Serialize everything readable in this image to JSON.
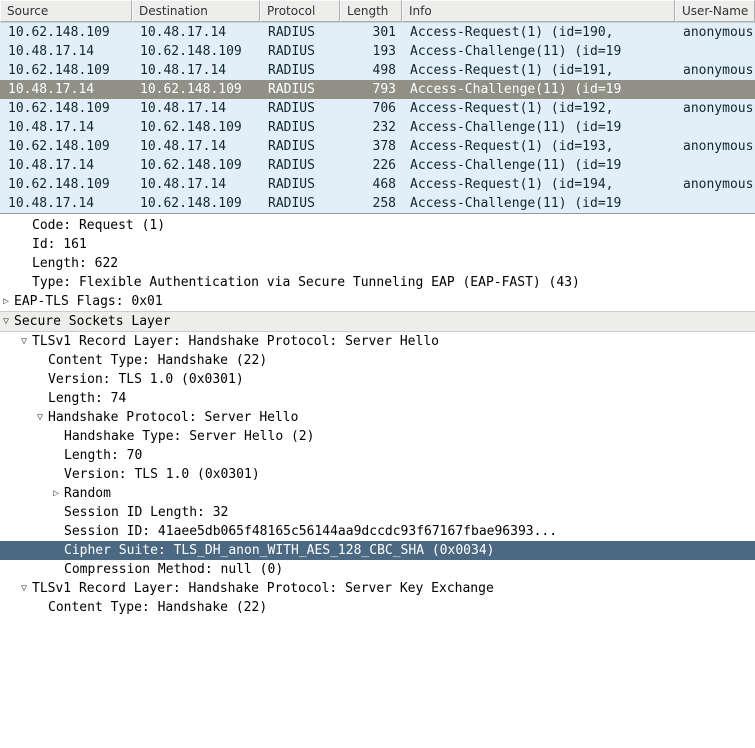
{
  "columns": {
    "source": "Source",
    "dest": "Destination",
    "proto": "Protocol",
    "length": "Length",
    "info": "Info",
    "user": "User-Name"
  },
  "packets": [
    {
      "source": "10.62.148.109",
      "dest": "10.48.17.14",
      "proto": "RADIUS",
      "length": "301",
      "info": "Access-Request(1) (id=190,",
      "user": "anonymous",
      "selected": false
    },
    {
      "source": "10.48.17.14",
      "dest": "10.62.148.109",
      "proto": "RADIUS",
      "length": "193",
      "info": "Access-Challenge(11) (id=19",
      "user": "",
      "selected": false
    },
    {
      "source": "10.62.148.109",
      "dest": "10.48.17.14",
      "proto": "RADIUS",
      "length": "498",
      "info": "Access-Request(1) (id=191,",
      "user": "anonymous",
      "selected": false
    },
    {
      "source": "10.48.17.14",
      "dest": "10.62.148.109",
      "proto": "RADIUS",
      "length": "793",
      "info": "Access-Challenge(11) (id=19",
      "user": "",
      "selected": true
    },
    {
      "source": "10.62.148.109",
      "dest": "10.48.17.14",
      "proto": "RADIUS",
      "length": "706",
      "info": "Access-Request(1) (id=192,",
      "user": "anonymous",
      "selected": false
    },
    {
      "source": "10.48.17.14",
      "dest": "10.62.148.109",
      "proto": "RADIUS",
      "length": "232",
      "info": "Access-Challenge(11) (id=19",
      "user": "",
      "selected": false
    },
    {
      "source": "10.62.148.109",
      "dest": "10.48.17.14",
      "proto": "RADIUS",
      "length": "378",
      "info": "Access-Request(1) (id=193,",
      "user": "anonymous",
      "selected": false
    },
    {
      "source": "10.48.17.14",
      "dest": "10.62.148.109",
      "proto": "RADIUS",
      "length": "226",
      "info": "Access-Challenge(11) (id=19",
      "user": "",
      "selected": false
    },
    {
      "source": "10.62.148.109",
      "dest": "10.48.17.14",
      "proto": "RADIUS",
      "length": "468",
      "info": "Access-Request(1) (id=194,",
      "user": "anonymous",
      "selected": false
    },
    {
      "source": "10.48.17.14",
      "dest": "10.62.148.109",
      "proto": "RADIUS",
      "length": "258",
      "info": "Access-Challenge(11) (id=19",
      "user": "",
      "selected": false
    }
  ],
  "details": [
    {
      "indent": 1,
      "toggle": "none",
      "text": "Code: Request (1)",
      "hl": false,
      "section": false
    },
    {
      "indent": 1,
      "toggle": "none",
      "text": "Id: 161",
      "hl": false,
      "section": false
    },
    {
      "indent": 1,
      "toggle": "none",
      "text": "Length: 622",
      "hl": false,
      "section": false
    },
    {
      "indent": 1,
      "toggle": "none",
      "text": "Type: Flexible Authentication via Secure Tunneling EAP (EAP-FAST) (43)",
      "hl": false,
      "section": false
    },
    {
      "indent": 0,
      "toggle": "closed",
      "text": "EAP-TLS Flags: 0x01",
      "hl": false,
      "section": false
    },
    {
      "indent": 0,
      "toggle": "open",
      "text": "Secure Sockets Layer",
      "hl": false,
      "section": true
    },
    {
      "indent": 1,
      "toggle": "open",
      "text": "TLSv1 Record Layer: Handshake Protocol: Server Hello",
      "hl": false,
      "section": false
    },
    {
      "indent": 2,
      "toggle": "none",
      "text": "Content Type: Handshake (22)",
      "hl": false,
      "section": false
    },
    {
      "indent": 2,
      "toggle": "none",
      "text": "Version: TLS 1.0 (0x0301)",
      "hl": false,
      "section": false
    },
    {
      "indent": 2,
      "toggle": "none",
      "text": "Length: 74",
      "hl": false,
      "section": false
    },
    {
      "indent": 2,
      "toggle": "open",
      "text": "Handshake Protocol: Server Hello",
      "hl": false,
      "section": false
    },
    {
      "indent": 3,
      "toggle": "none",
      "text": "Handshake Type: Server Hello (2)",
      "hl": false,
      "section": false
    },
    {
      "indent": 3,
      "toggle": "none",
      "text": "Length: 70",
      "hl": false,
      "section": false
    },
    {
      "indent": 3,
      "toggle": "none",
      "text": "Version: TLS 1.0 (0x0301)",
      "hl": false,
      "section": false
    },
    {
      "indent": 3,
      "toggle": "closed",
      "text": "Random",
      "hl": false,
      "section": false
    },
    {
      "indent": 3,
      "toggle": "none",
      "text": "Session ID Length: 32",
      "hl": false,
      "section": false
    },
    {
      "indent": 3,
      "toggle": "none",
      "text": "Session ID: 41aee5db065f48165c56144aa9dccdc93f67167fbae96393...",
      "hl": false,
      "section": false
    },
    {
      "indent": 3,
      "toggle": "none",
      "text": "Cipher Suite: TLS_DH_anon_WITH_AES_128_CBC_SHA (0x0034)",
      "hl": true,
      "section": false
    },
    {
      "indent": 3,
      "toggle": "none",
      "text": "Compression Method: null (0)",
      "hl": false,
      "section": false
    },
    {
      "indent": 1,
      "toggle": "open",
      "text": "TLSv1 Record Layer: Handshake Protocol: Server Key Exchange",
      "hl": false,
      "section": false
    },
    {
      "indent": 2,
      "toggle": "none",
      "text": "Content Type: Handshake (22)",
      "hl": false,
      "section": false
    }
  ]
}
